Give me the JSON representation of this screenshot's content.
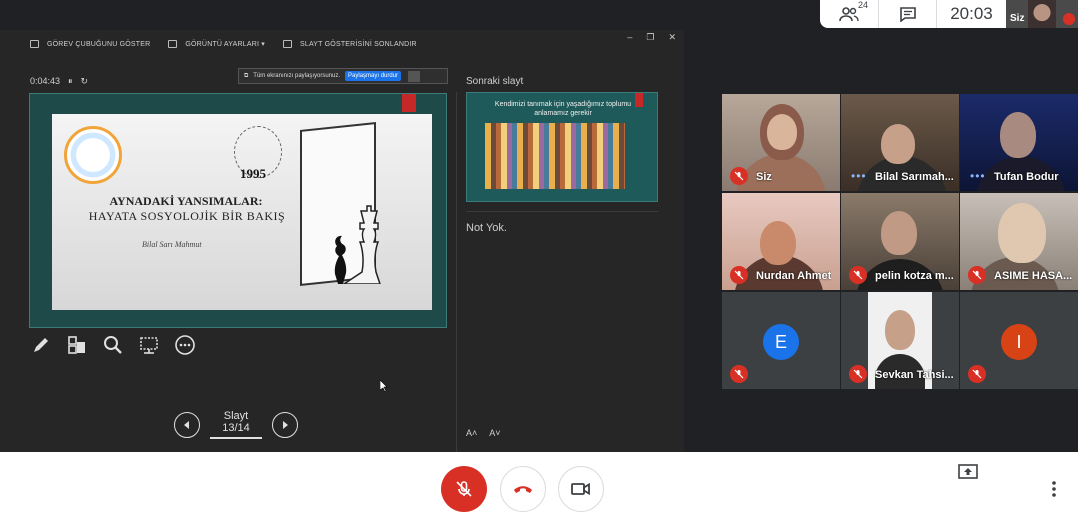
{
  "topbar": {
    "participants_count": "24",
    "time": "20:03",
    "self_label": "Siz"
  },
  "presentation": {
    "toolbar": {
      "show_taskbar": "GÖREV ÇUBUĞUNU GÖSTER",
      "display_settings": "GÖRÜNTÜ AYARLARI ▾",
      "end_slideshow": "SLAYT GÖSTERİSİNİ SONLANDIR"
    },
    "timer": "0:04:43",
    "sharebar": {
      "text": "Tüm ekranınızı paylaşıyorsunuz.",
      "stop_label": "Paylaşmayı durdur"
    },
    "slide": {
      "year": "1995",
      "title_line1": "AYNADAKİ YANSIMALAR:",
      "title_line2": "HAYATA SOSYOLOJİK BİR BAKIŞ",
      "author": "Bilal Sarı Mahmut"
    },
    "slide_counter": "Slayt 13/14",
    "next_slide_label": "Sonraki slayt",
    "next_slide_text": "Kendimizi tanımak için yaşadığımız toplumu anlamamız gerekir",
    "notes": "Not Yok.",
    "font_larger": "A˄",
    "font_smaller": "A˅"
  },
  "participants": [
    {
      "name": "Siz",
      "state": "muted"
    },
    {
      "name": "Bilal Sarımah...",
      "state": "speaking"
    },
    {
      "name": "Tufan Bodur",
      "state": "speaking"
    },
    {
      "name": "Nurdan Ahmet",
      "state": "muted"
    },
    {
      "name": "pelin kotza m...",
      "state": "muted"
    },
    {
      "name": "ASIME HASA...",
      "state": "muted"
    },
    {
      "name": "",
      "initial": "E",
      "avatar_color": "#1a73e8",
      "state": "muted"
    },
    {
      "name": "Sevkan Tahsi...",
      "state": "muted"
    },
    {
      "name": "",
      "initial": "I",
      "avatar_color": "#d84315",
      "state": "muted"
    }
  ],
  "colors": {
    "accent_red": "#d93025",
    "speaking_blue": "#8ab4f8",
    "slide_teal": "#1f4a4a"
  }
}
